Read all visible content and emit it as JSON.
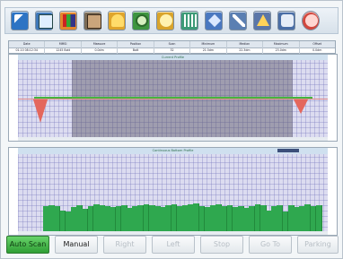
{
  "toolbar": {
    "tools": [
      {
        "icon": "arrow-icon",
        "color": "#2d74c4"
      },
      {
        "icon": "monitor-icon",
        "color": "#3f78b8"
      },
      {
        "icon": "chart-icon",
        "color": "#e3862c"
      },
      {
        "icon": "photo-icon",
        "color": "#7a6b57"
      },
      {
        "icon": "bell-icon",
        "color": "#e0a52b"
      },
      {
        "icon": "leaf-icon",
        "color": "#3e9540"
      },
      {
        "icon": "person-icon",
        "color": "#d9a42b"
      },
      {
        "icon": "grid-icon",
        "color": "#3d9a77"
      },
      {
        "icon": "diamond-arrow-icon",
        "color": "#4a78c0"
      },
      {
        "icon": "tool-icon",
        "color": "#5a7fb2"
      },
      {
        "icon": "warning-icon",
        "color": "#5a76a8"
      },
      {
        "icon": "phone-icon",
        "color": "#4a6ea6"
      },
      {
        "icon": "stop-icon",
        "color": "#d2473d"
      }
    ]
  },
  "info_table": {
    "columns": [
      "Date",
      "MMSI",
      "Measure",
      "Position",
      "Scan",
      "Minimum",
      "Median",
      "Maximum",
      "Offset"
    ],
    "values": [
      "01.10 08:12:34",
      "1245 Bott",
      "0.0dm",
      "Bott",
      "32",
      "21.5dm",
      "22.3dm",
      "23.0dm",
      "0.0dm"
    ]
  },
  "chart_top": {
    "title": "Current Profile"
  },
  "chart_bottom": {
    "title": "Continuous Bottom Profile",
    "bars": [
      30,
      31,
      30,
      25,
      24,
      29,
      31,
      27,
      30,
      32,
      31,
      30,
      29,
      30,
      31,
      28,
      30,
      31,
      32,
      31,
      30,
      29,
      31,
      32,
      30,
      31,
      32,
      33,
      30,
      29,
      31,
      32,
      30,
      31,
      29,
      30,
      28,
      30,
      32,
      31,
      25,
      30,
      31,
      24,
      31,
      29,
      30,
      32,
      30,
      31
    ]
  },
  "buttons": [
    "Auto Scan",
    "Manual",
    "Right",
    "Left",
    "Stop",
    "Go To",
    "Parking"
  ]
}
